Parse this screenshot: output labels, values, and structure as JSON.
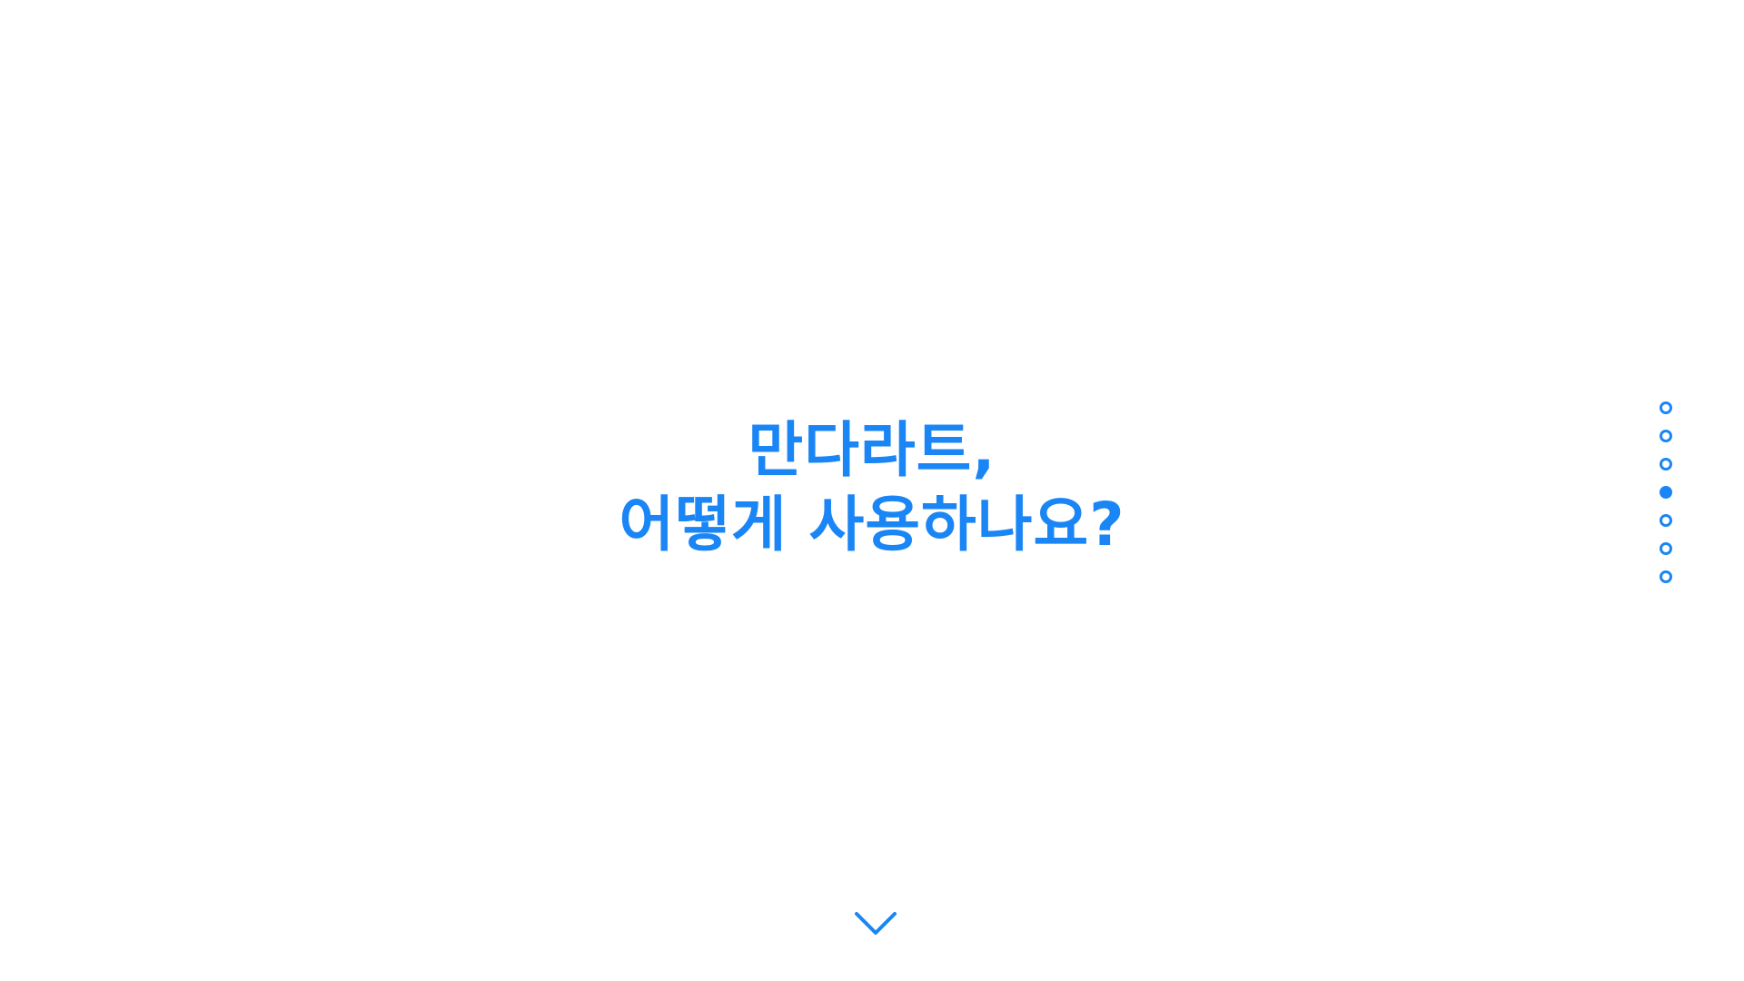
{
  "theme": {
    "accent": "#1a85f5",
    "background": "#ffffff"
  },
  "hero": {
    "title_line1": "만다라트,",
    "title_line2": "어떻게 사용하나요?"
  },
  "pagination": {
    "total": 7,
    "current": 4
  },
  "scroll_icon": "chevron-down-icon"
}
